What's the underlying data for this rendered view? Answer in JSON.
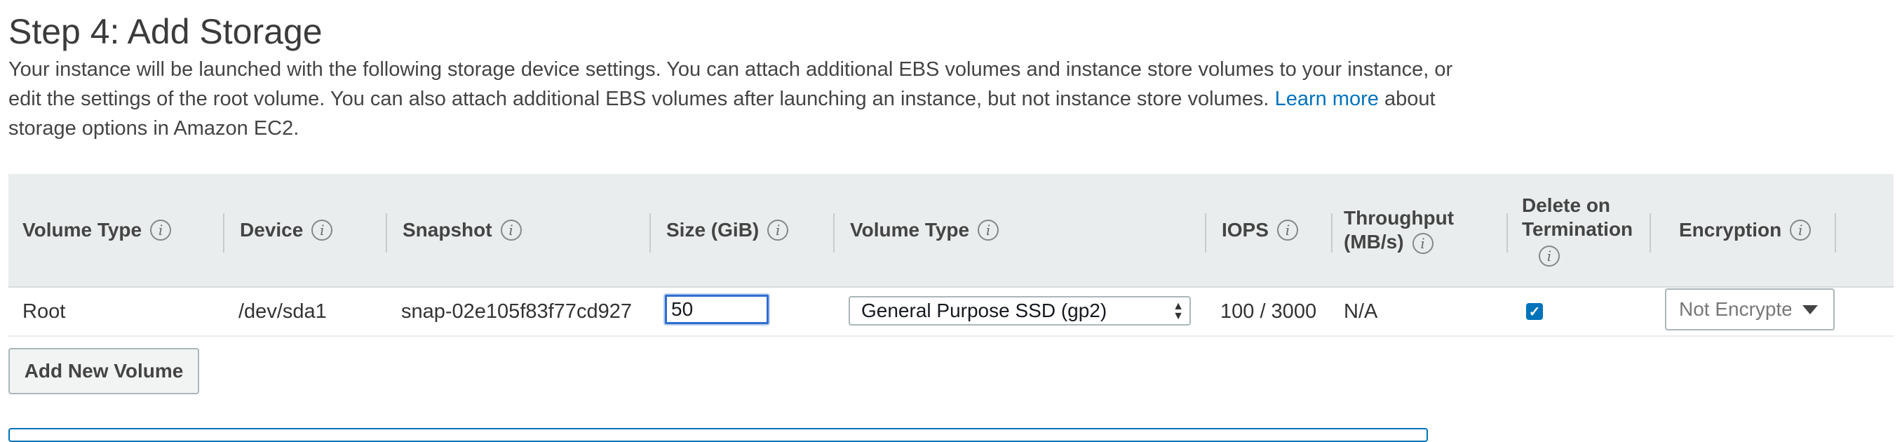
{
  "page": {
    "title": "Step 4: Add Storage",
    "description_1": "Your instance will be launched with the following storage device settings. You can attach additional EBS volumes and instance store volumes to your instance, or edit the settings of the root volume. You can also attach additional EBS volumes after launching an instance, but not instance store volumes.",
    "learn_more": "Learn more",
    "description_2": "about storage options in Amazon EC2."
  },
  "table": {
    "headers": {
      "volume_type": "Volume Type",
      "device": "Device",
      "snapshot": "Snapshot",
      "size": "Size (GiB)",
      "ebs_volume_type": "Volume Type",
      "iops": "IOPS",
      "throughput_1": "Throughput",
      "throughput_2": "(MB/s)",
      "delete_1": "Delete on",
      "delete_2": "Termination",
      "encryption": "Encryption"
    },
    "row": {
      "volume_type": "Root",
      "device": "/dev/sda1",
      "snapshot": "snap-02e105f83f77cd927",
      "size": "50",
      "ebs_volume_type": "General Purpose SSD (gp2)",
      "iops": "100 / 3000",
      "throughput": "N/A",
      "delete_on_termination": true,
      "encryption": "Not Encrypted"
    }
  },
  "actions": {
    "add_volume": "Add New Volume"
  },
  "icons": {
    "info": "i",
    "check": "✓"
  }
}
